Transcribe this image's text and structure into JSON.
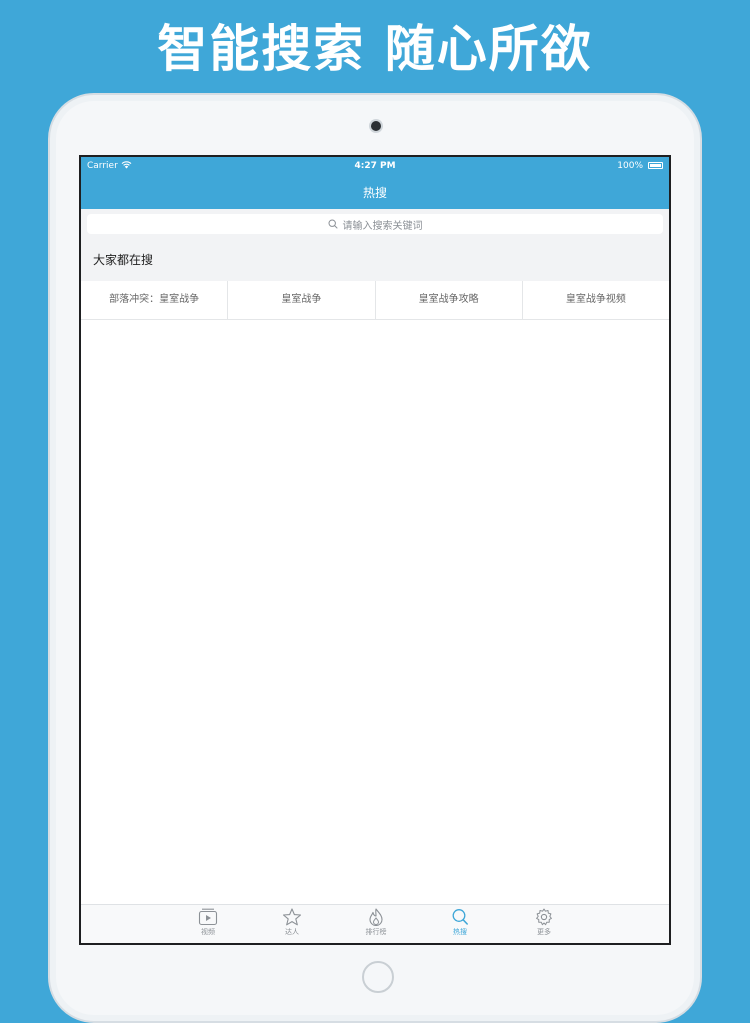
{
  "headline": "智能搜索 随心所欲",
  "status_bar": {
    "carrier": "Carrier",
    "time": "4:27 PM",
    "battery": "100%"
  },
  "nav": {
    "title": "热搜"
  },
  "search": {
    "placeholder": "请输入搜索关键词"
  },
  "section": {
    "title": "大家都在搜"
  },
  "hot_tags": [
    "部落冲突：皇室战争",
    "皇室战争",
    "皇室战争攻略",
    "皇室战争视频"
  ],
  "tabbar": {
    "items": [
      {
        "label": "视频",
        "icon": "video-icon"
      },
      {
        "label": "达人",
        "icon": "star-icon"
      },
      {
        "label": "排行榜",
        "icon": "flame-icon"
      },
      {
        "label": "热搜",
        "icon": "search-icon"
      },
      {
        "label": "更多",
        "icon": "gear-icon"
      }
    ],
    "active_index": 3
  },
  "colors": {
    "background": "#3fa7d8",
    "accent": "#3fa7d8",
    "tab_inactive": "#8c9196"
  }
}
